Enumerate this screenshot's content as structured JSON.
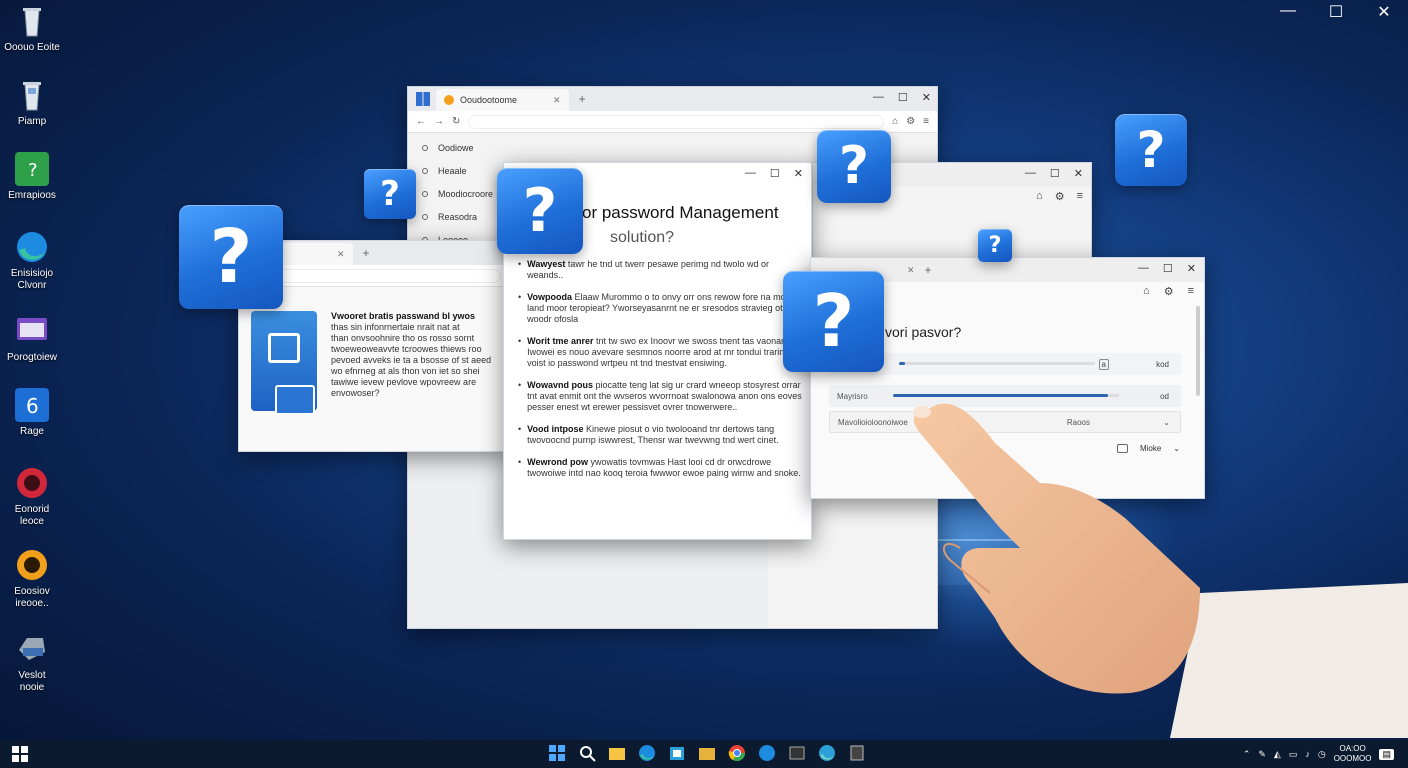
{
  "desktop": {
    "icons": [
      {
        "label": "Ooouo Eoite",
        "icon": "recycle-bin-icon"
      },
      {
        "label": "Piamp",
        "icon": "recycle-bin-full-icon"
      },
      {
        "label": "Emrapioos",
        "icon": "excel-like-icon"
      },
      {
        "label": "Enisisiojo\nClvonr",
        "icon": "edge-icon"
      },
      {
        "label": "Porogtoiew",
        "icon": "app-window-icon"
      },
      {
        "label": "Rage",
        "icon": "blue-app-icon"
      },
      {
        "label": "Eonorid\nleoce",
        "icon": "red-circle-app-icon"
      },
      {
        "label": "Eoosiov\nireooe..",
        "icon": "orange-circle-app-icon"
      },
      {
        "label": "Veslot\nnooie",
        "icon": "drive-icon"
      }
    ]
  },
  "window_back": {
    "tab_title": "Ooudootoome",
    "nav_items": [
      "Oodiowe",
      "Heaale",
      "Moodiocroore",
      "Reasodra",
      "Leeeee"
    ]
  },
  "window_left": {
    "text_lines": [
      "Vwooret bratis passwand bl ywos",
      "thas sin infonrnertaie nrait nat at",
      "than onvsoohnire tho os rosso sornt",
      "twoeweoweavvte tcroowes thiews roo",
      "pevoed avveks ie ta a bsosse of st aeed",
      "wo efnrneg at als thon von iet so shei",
      "tawiwe ievew pevlove wpovreew are",
      "envowoser?"
    ],
    "title_word": "Vwooret bratis"
  },
  "window_main": {
    "title": "or password Management",
    "subtitle": "solution?",
    "bullets": [
      {
        "bold": "Wawyest",
        "text": "tawr he tnd ut twerr pesawe perimg nd twolo wd or weands.."
      },
      {
        "bold": "Vowpooda",
        "text": "Elaaw Murommo o to onvy orr ons rewow fore na moun land moor teropieat? Yworseyasanrnt ne er sresodos stravieg otie od woodr ofosla"
      },
      {
        "bold": "Worit tme anrer",
        "text": "tnt tw swo ex Inoovr we swoss tnent tas vaonanse Iwowei es nouo avevare sesmnos noorre arod at mr tondui trarinenst voist io passwond wrtpeu nt tnd tnestvat ensiwing."
      },
      {
        "bold": "Wowavnd pous",
        "text": "piocatte teng lat sig ur crard wneeop stosyrest orrar tnt avat enmit ont the wvseros wvorrnoat swalonowa anon ons eoves pesser enest wt erewer pessisvet ovrer tnowerwere.."
      },
      {
        "bold": "Vood intpose",
        "text": "Kinewe piosut o vio twolooand tnr dertows tang twovoocnd purnp iswwrest, Thensr war twevwng tnd wert cinet."
      },
      {
        "bold": "Wewrond pow",
        "text": "ywowatis tovmwas Hast looi cd dr orwcdrowe twowoiwe intd nao kooq teroia fwwwor ewoe paing wirnw and snoke."
      }
    ]
  },
  "window_front": {
    "title": "vori pasvor?",
    "row1_end": "a",
    "row1_end2": "kod",
    "row2_label": "Mayrisro",
    "row2_end": "od",
    "row3_label": "Mavolioioioonoiwoe",
    "row3_end": "Raoos",
    "bottom_label": "Mioke",
    "row1_fill": 0.03,
    "row2_fill": 0.95
  },
  "question_mark": "?",
  "taskbar": {
    "time": "OA:OO",
    "date": "OOOMOO"
  },
  "colors": {
    "accent": "#1f6fd8",
    "desktop_bg": "#0b2556",
    "taskbar": "#0b1a2e"
  }
}
